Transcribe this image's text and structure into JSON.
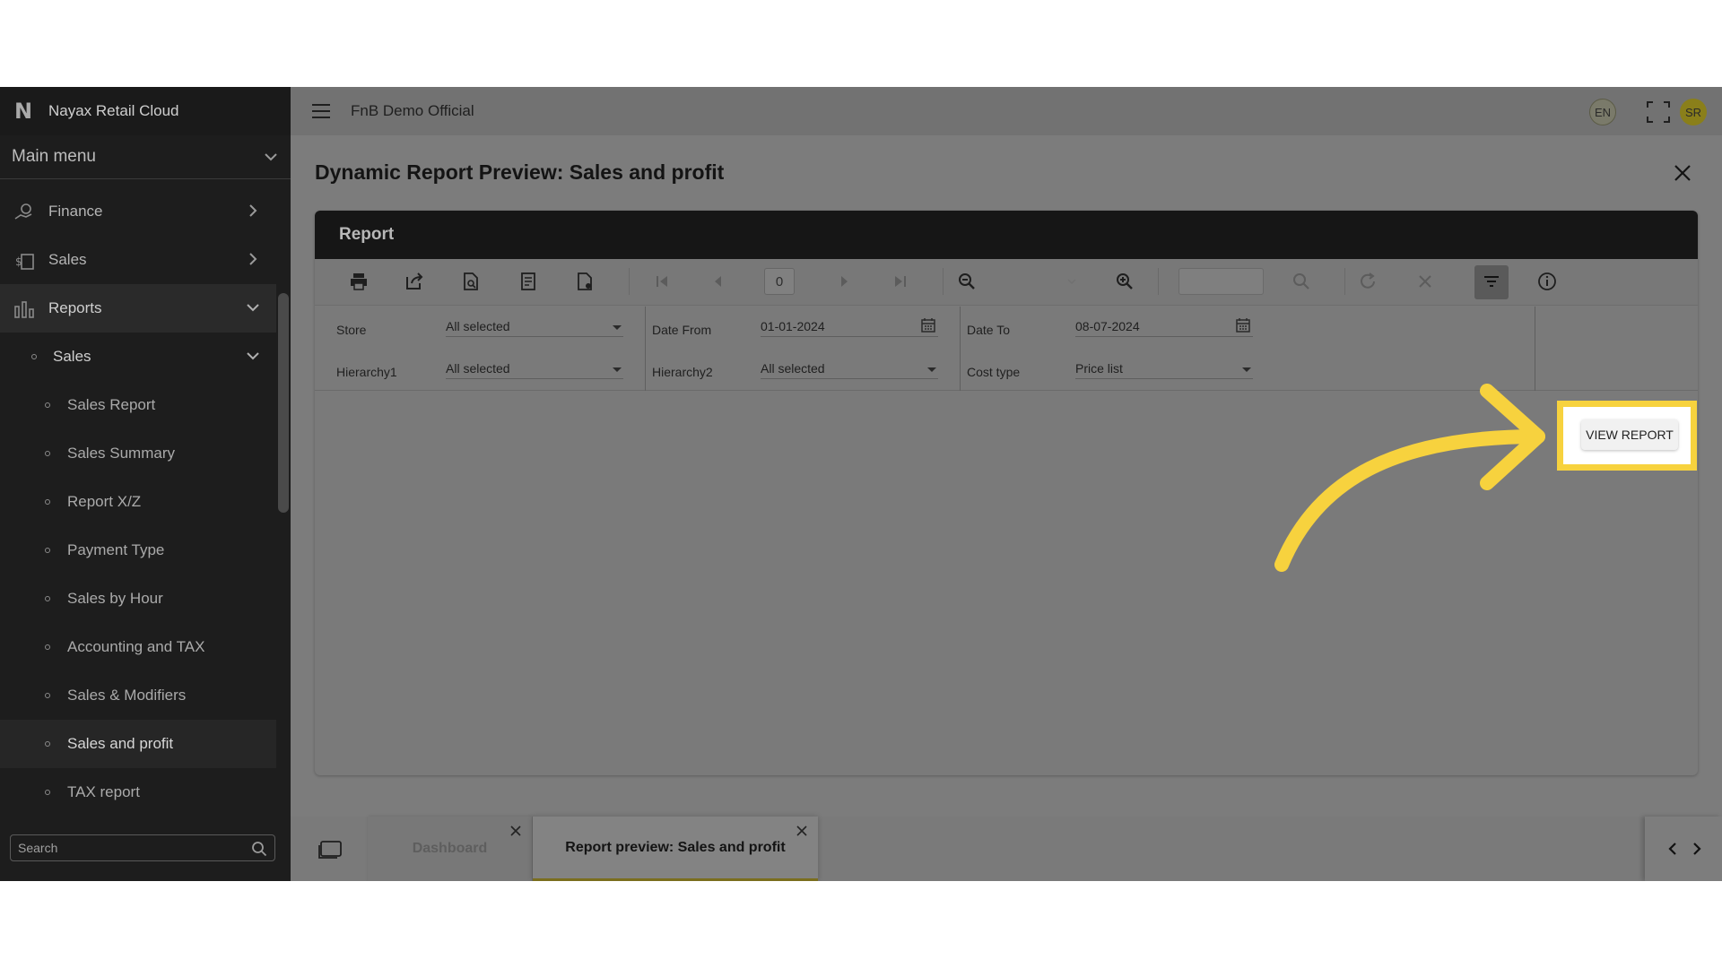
{
  "sidebar": {
    "brand": "Nayax Retail Cloud",
    "main_menu": "Main menu",
    "items": [
      {
        "label": "Finance",
        "icon": "finance-icon"
      },
      {
        "label": "Sales",
        "icon": "sales-icon"
      },
      {
        "label": "Reports",
        "icon": "reports-icon",
        "expanded": true
      }
    ],
    "reports_sub": {
      "label": "Sales",
      "expanded": true
    },
    "leaves": [
      "Sales Report",
      "Sales Summary",
      "Report X/Z",
      "Payment Type",
      "Sales by Hour",
      "Accounting and TAX",
      "Sales & Modifiers",
      "Sales and profit",
      "TAX report"
    ],
    "active_leaf": "Sales and profit",
    "search_placeholder": "Search"
  },
  "topbar": {
    "org_name": "FnB Demo Official",
    "language": "EN",
    "user_initials": "SR"
  },
  "page": {
    "title": "Dynamic Report Preview: Sales and profit",
    "panel_title": "Report",
    "page_number": "0"
  },
  "params": {
    "store_label": "Store",
    "store_value": "All selected",
    "date_from_label": "Date From",
    "date_from_value": "01-01-2024",
    "date_to_label": "Date To",
    "date_to_value": "08-07-2024",
    "hierarchy1_label": "Hierarchy1",
    "hierarchy1_value": "All selected",
    "hierarchy2_label": "Hierarchy2",
    "hierarchy2_value": "All selected",
    "cost_type_label": "Cost type",
    "cost_type_value": "Price list",
    "view_report_label": "VIEW REPORT"
  },
  "tabs": [
    {
      "label": "Dashboard",
      "active": false
    },
    {
      "label": "Report preview: Sales and profit",
      "active": true
    }
  ],
  "colors": {
    "highlight": "#f7d23e",
    "arrow": "#f7d23e",
    "sidebar_bg": "#1d1d1d",
    "panel_header_bg": "#161616"
  }
}
